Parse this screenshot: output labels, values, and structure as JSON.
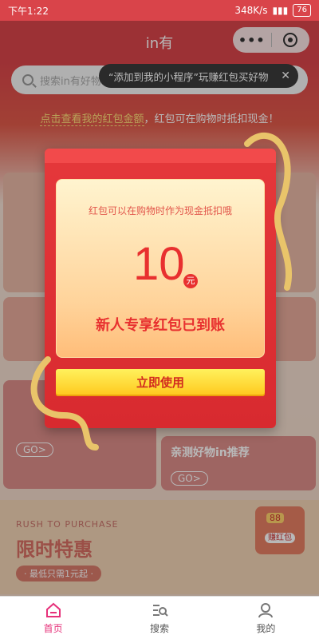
{
  "status_bar": {
    "time": "下午1:22",
    "net_speed": "348K/s",
    "battery": "76"
  },
  "header": {
    "title": "in有",
    "more_label": "•••"
  },
  "search": {
    "placeholder": "搜索in有好物"
  },
  "tooltip": {
    "text": "“添加到我的小程序”玩赚红包买好物",
    "close": "✕"
  },
  "hint": {
    "link": "点击查看我的红包金额",
    "text": "，红包可在购物时抵扣现金！"
  },
  "background": {
    "go_label_1": "GO>",
    "go_label_2": "GO>",
    "recommend": "亲测好物in推荐",
    "rush": "RUSH TO PURCHASE",
    "limited": "限时特惠",
    "min_price": "· 最低只需1元起 ·",
    "coupon_badge_num": "88",
    "coupon_badge_label": "赚红包"
  },
  "modal": {
    "subtitle": "红包可以在购物时作为现金抵扣哦",
    "amount": "10",
    "unit": "元",
    "title": "新人专享红包已到账",
    "button": "立即使用"
  },
  "tabbar": {
    "home": "首页",
    "search": "搜索",
    "mine": "我的"
  },
  "colors": {
    "accent": "#e6317a",
    "envelope_red": "#d82a2f",
    "button_yellow": "#ffd62e"
  }
}
